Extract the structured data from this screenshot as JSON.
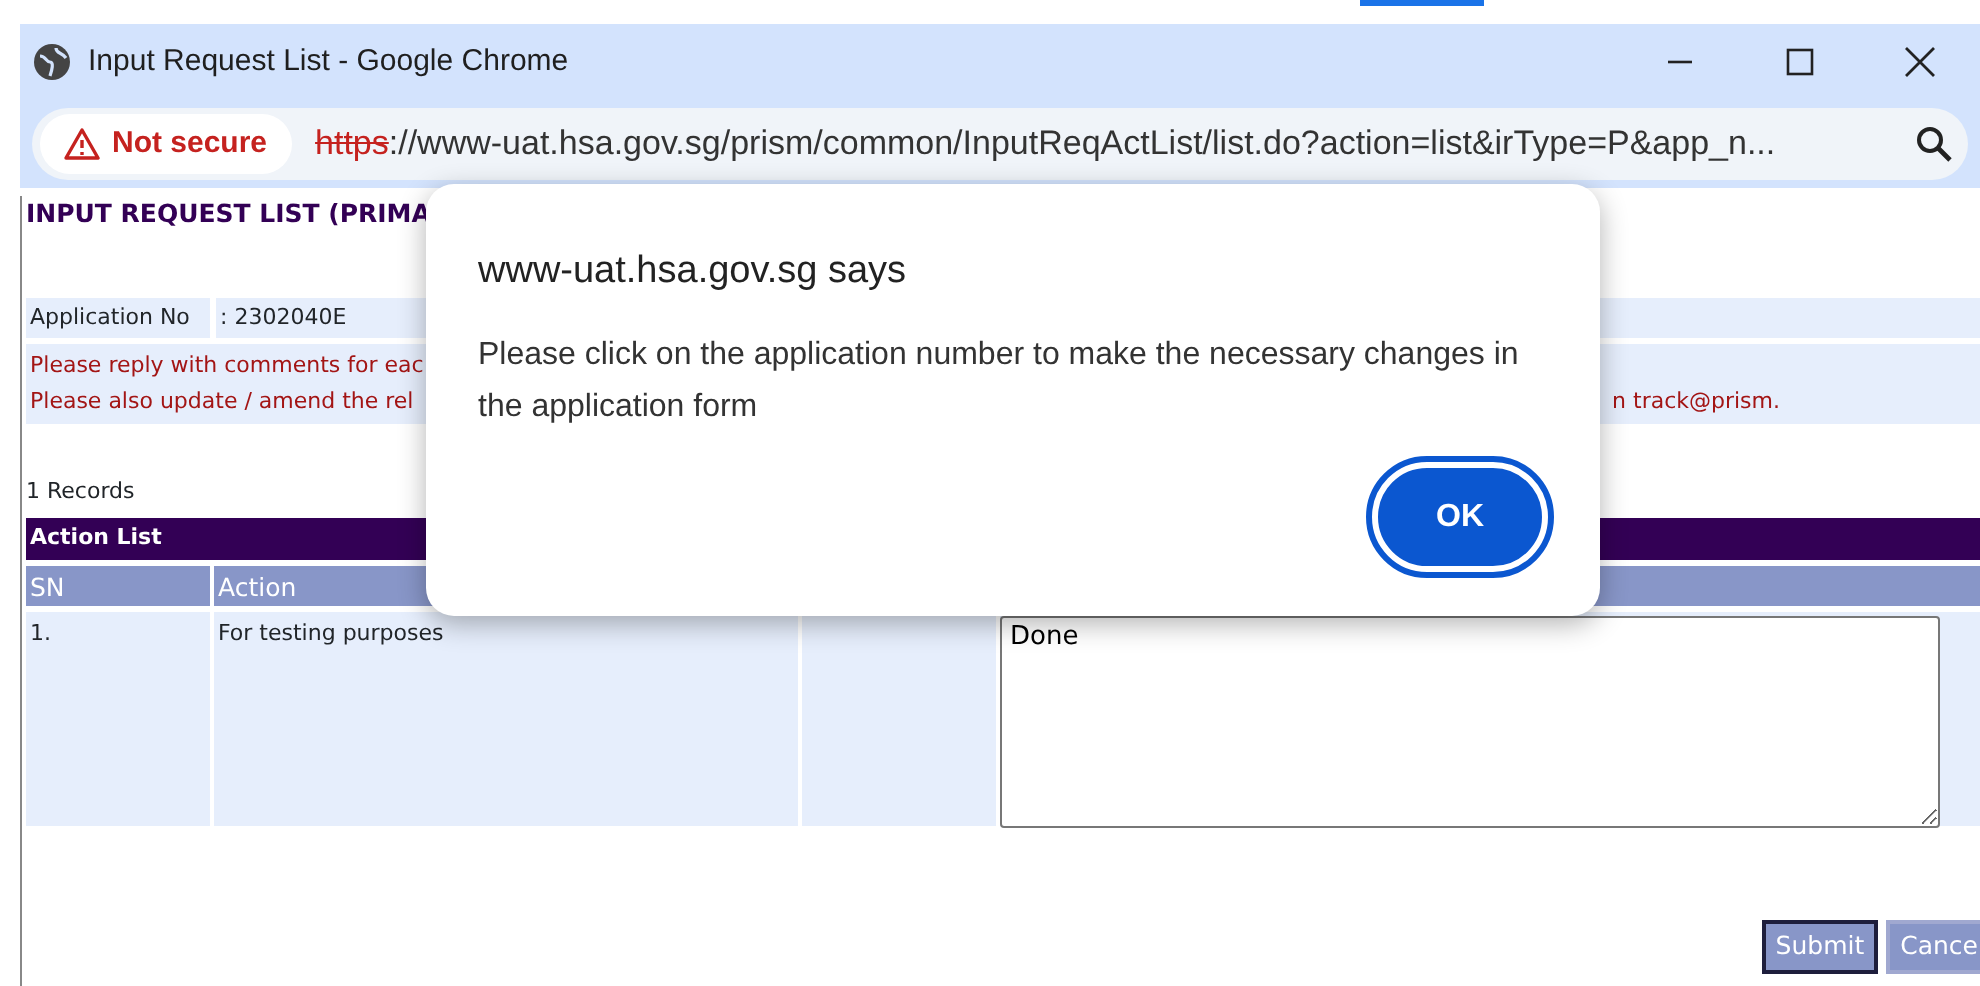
{
  "window": {
    "title": "Input Request List - Google Chrome"
  },
  "address_bar": {
    "security_label": "Not secure",
    "url_scheme": "https",
    "url_rest": "://www-uat.hsa.gov.sg/prism/common/InputReqActList/list.do?action=list&irType=P&app_n..."
  },
  "page": {
    "heading": "INPUT REQUEST LIST (PRIMA",
    "application_no_label": "Application No",
    "application_no_value": ": 2302040E",
    "notes": [
      {
        "left": "Please reply with comments for eac"
      },
      {
        "left": "Please also update / amend the rel",
        "right": "n track@prism."
      }
    ],
    "record_count": "1 Records",
    "table": {
      "title": "Action List",
      "columns": [
        "SN",
        "Action"
      ],
      "rows": [
        {
          "sn": "1.",
          "action": "For testing purposes",
          "reply": "Done"
        }
      ]
    },
    "buttons": [
      "Submit",
      "Cance"
    ]
  },
  "dialog": {
    "title": "www-uat.hsa.gov.sg says",
    "message": "Please click on the application number to make the necessary changes in the application form",
    "button": "OK"
  }
}
